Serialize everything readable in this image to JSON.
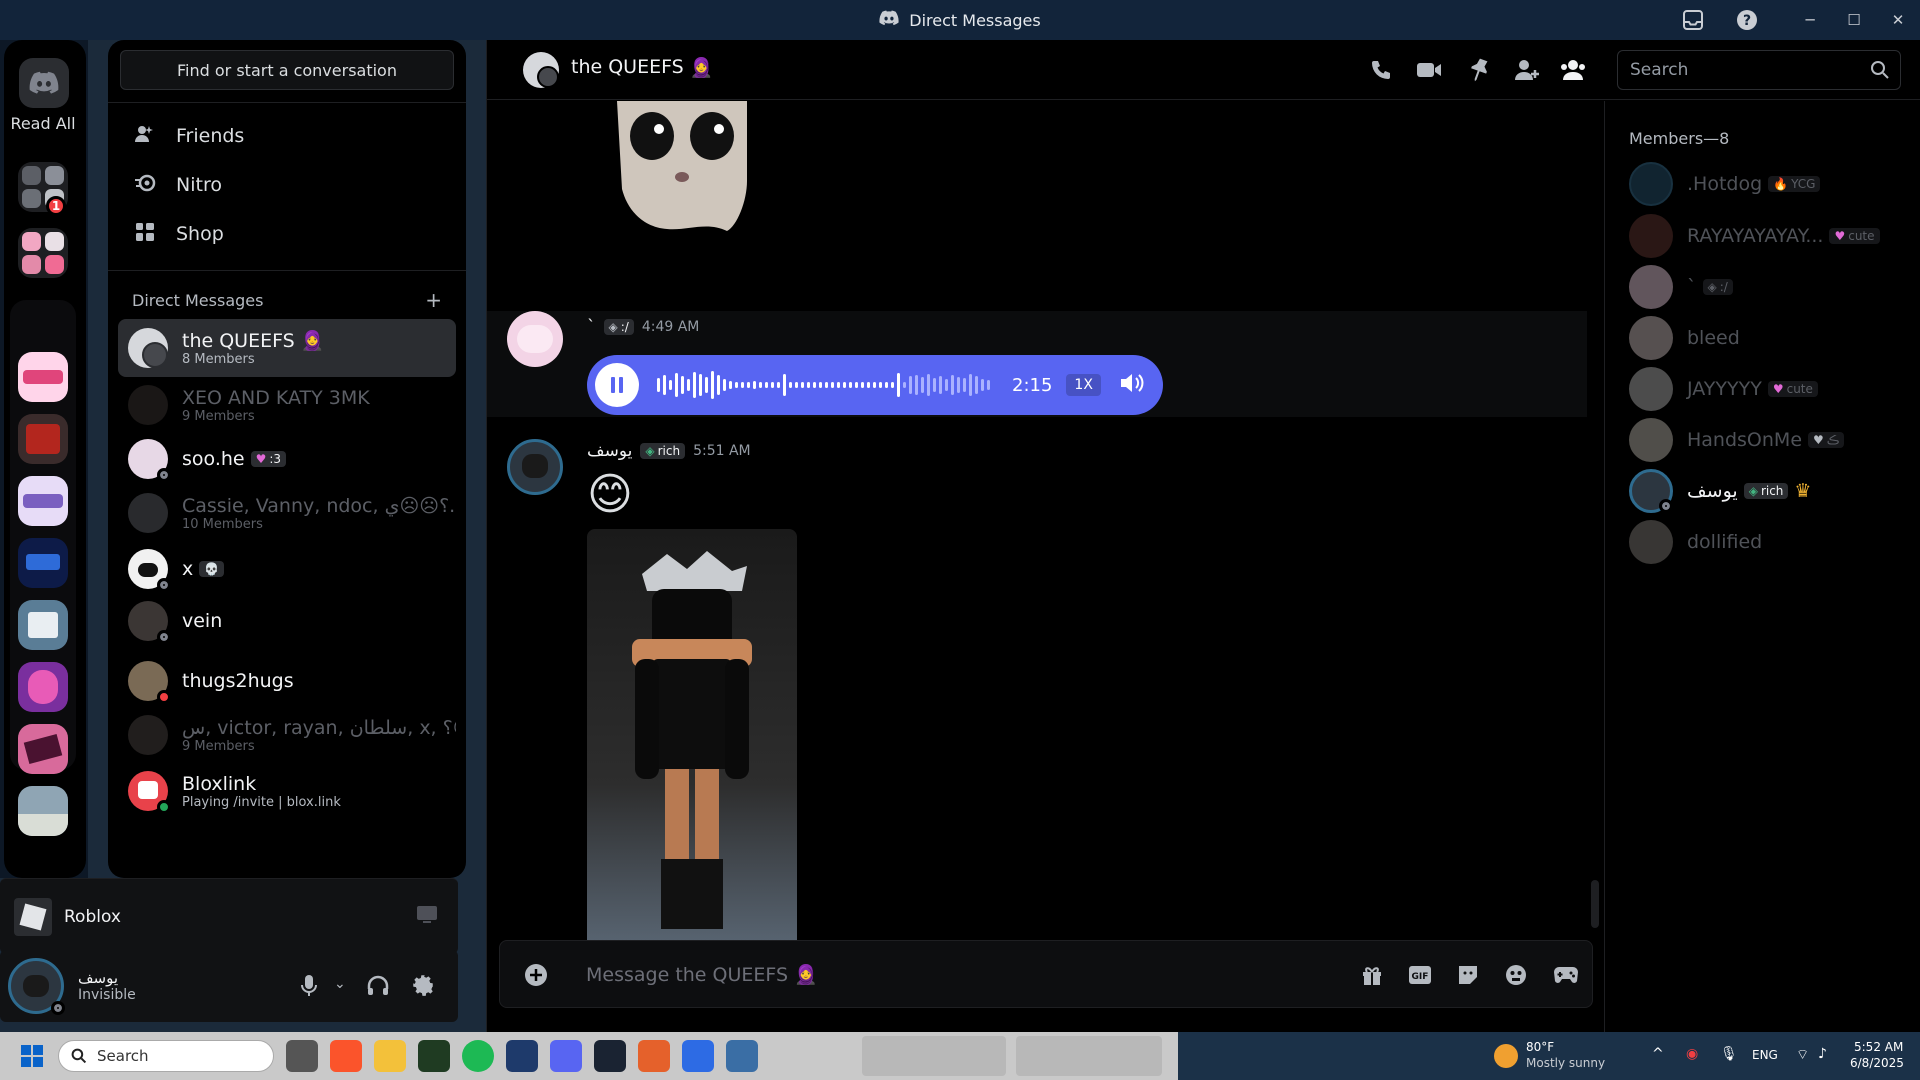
{
  "window": {
    "title": "Direct Messages"
  },
  "servers": {
    "read_all": "Read All",
    "folder_badge": "1"
  },
  "sidebar": {
    "find_placeholder": "Find or start a conversation",
    "nav": [
      {
        "label": "Friends",
        "icon": "friends-icon"
      },
      {
        "label": "Nitro",
        "icon": "nitro-icon"
      },
      {
        "label": "Shop",
        "icon": "shop-icon"
      }
    ],
    "dm_header": "Direct Messages",
    "dms": [
      {
        "name": "the QUEEFS",
        "emoji": "🧕",
        "sub": "8 Members",
        "active": true
      },
      {
        "name": "XEO AND KATY 3MK",
        "sub": "9 Members",
        "dim": true
      },
      {
        "name": "soo.he",
        "tag": ":3",
        "status": "invisible"
      },
      {
        "name": "Cassie, Vanny, ndoc, ؟☹☹ي...",
        "sub": "10 Members",
        "dim": true
      },
      {
        "name": "x",
        "status": "invisible"
      },
      {
        "name": "vein",
        "status": "invisible"
      },
      {
        "name": "thugs2hugs",
        "status": "dnd"
      },
      {
        "name": "س, victor, rayan, سلطان, x, ؟☹...",
        "sub": "9 Members",
        "dim": true
      },
      {
        "name": "Bloxlink",
        "sub": "Playing /invite | blox.link",
        "status": "online"
      }
    ]
  },
  "activity": {
    "app": "Roblox"
  },
  "user": {
    "name": "يوسف",
    "status": "Invisible"
  },
  "chat": {
    "header_title": "the QUEEFS",
    "header_emoji": "🧕",
    "search_placeholder": "Search",
    "messages": [
      {
        "author": "`",
        "tag": ":/",
        "time": "4:49 AM",
        "voice_duration": "2:15",
        "speed": "1X",
        "voice_progress": 0.02
      },
      {
        "author": "يوسف",
        "tag": "rich",
        "time": "5:51 AM",
        "emoji": "😊"
      }
    ],
    "reactions": [
      "😭",
      "💞",
      "❤️"
    ],
    "composer_placeholder": "Message the QUEEFS 🧕"
  },
  "members": {
    "title": "Members—8",
    "list": [
      {
        "name": ".Hotdog",
        "tag": "YCG",
        "off": true
      },
      {
        "name": "RAYAYAYAYAY...",
        "tag": "cute",
        "off": true
      },
      {
        "name": "`",
        "tag": ":/",
        "off": true
      },
      {
        "name": "bleed",
        "off": true
      },
      {
        "name": "JAYYYYY",
        "tag": "cute",
        "off": true
      },
      {
        "name": "HandsOnMe",
        "tag": "ڪ",
        "off": true
      },
      {
        "name": "يوسف",
        "tag": "rich",
        "crown": true,
        "off": false
      },
      {
        "name": "dollified",
        "off": true
      }
    ]
  },
  "taskbar": {
    "search": "Search",
    "weather_temp": "80°F",
    "weather_desc": "Mostly sunny",
    "lang": "ENG",
    "time": "5:52 AM",
    "date": "6/8/2025"
  }
}
